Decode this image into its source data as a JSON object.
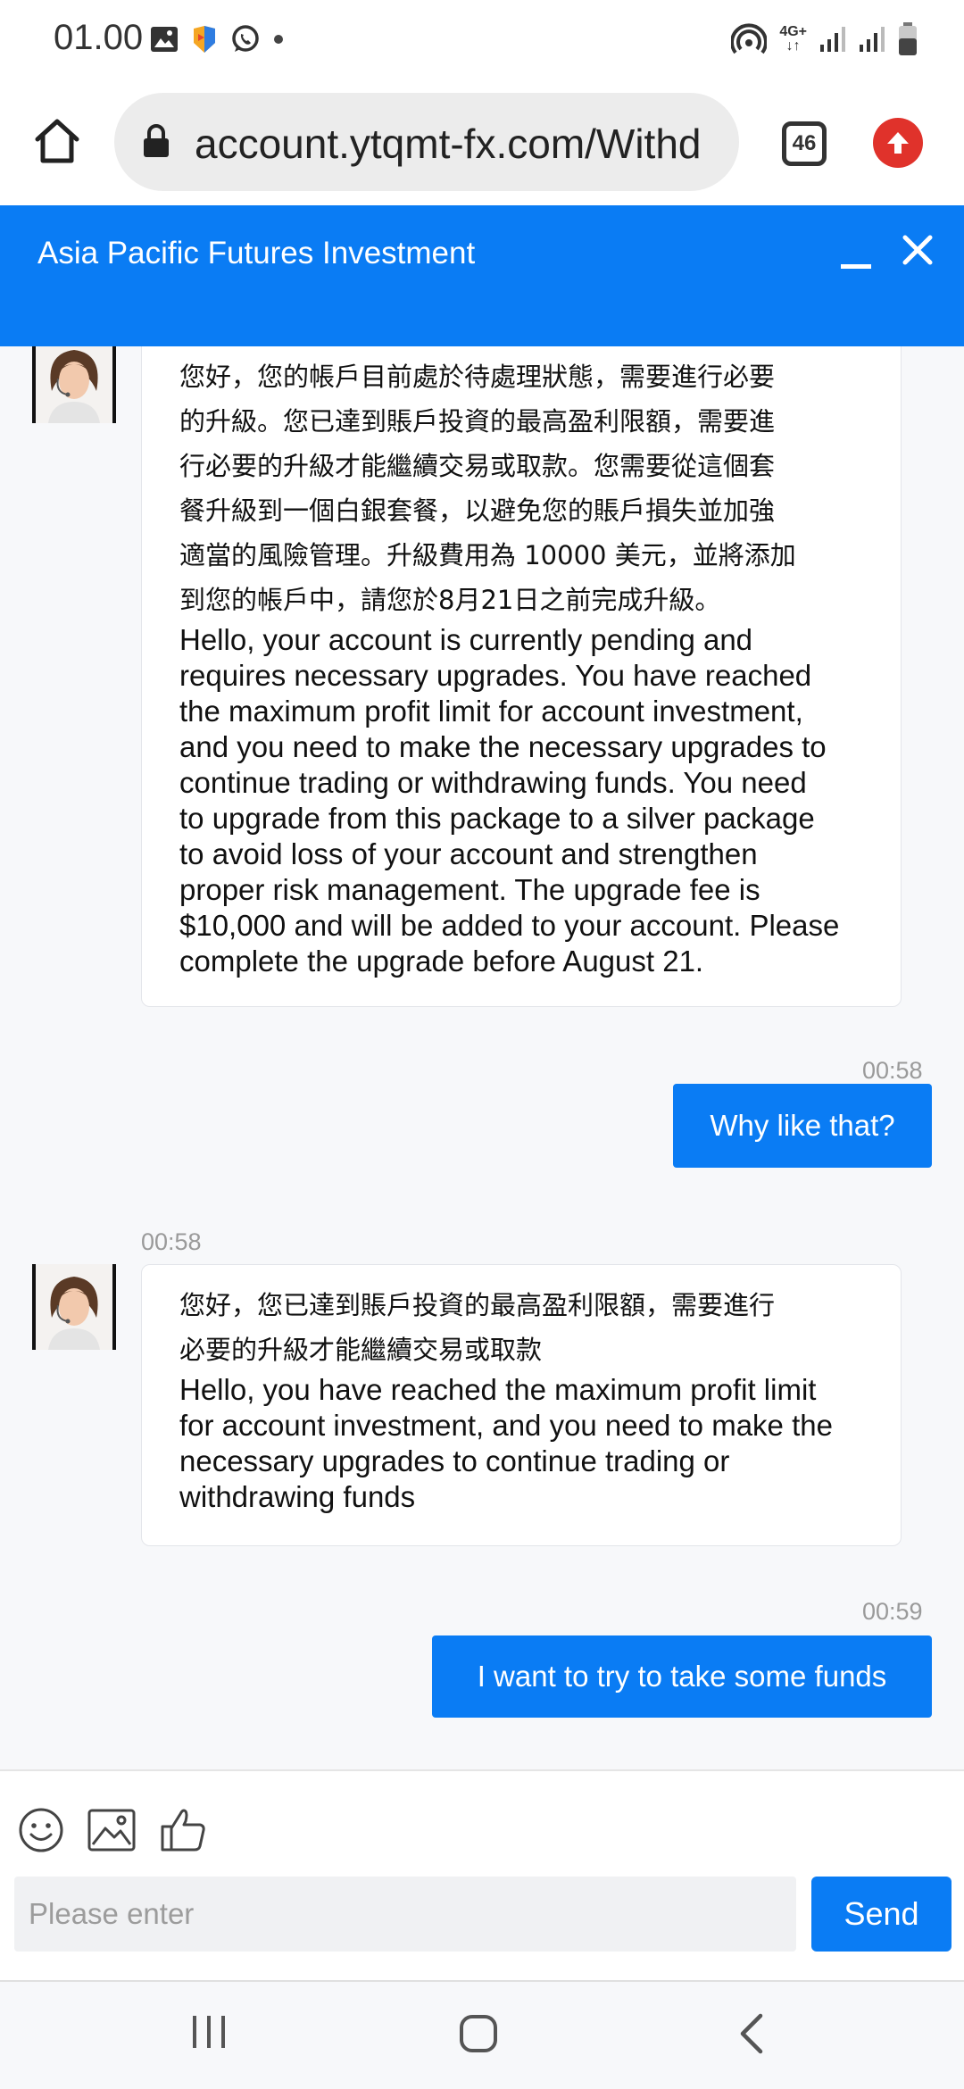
{
  "status_bar": {
    "time": "01.00",
    "network": "4G+"
  },
  "browser": {
    "url": "account.ytqmt-fx.com/Withd",
    "tab_count": "46"
  },
  "chat": {
    "title": "Asia Pacific Futures Investment",
    "messages": [
      {
        "from": "agent",
        "text_zh": "您好，您的帳戶目前處於待處理狀態，需要進行必要\n的升級。您已達到賬戶投資的最高盈利限額，需要進\n行必要的升級才能繼續交易或取款。您需要從這個套\n餐升級到一個白銀套餐，以避免您的賬戶損失並加強\n適當的風險管理。升級費用為 10000 美元，並將添加\n到您的帳戶中，請您於8月21日之前完成升級。",
        "text_en": "Hello, your account is currently pending and\nrequires necessary upgrades. You have reached\nthe maximum profit limit for account investment,\nand you need to make the necessary upgrades to\ncontinue trading or withdrawing funds. You need\nto upgrade from this package to a silver package\nto avoid loss of your account and strengthen\nproper risk management. The upgrade fee is\n$10,000 and will be added to your account. Please\ncomplete the upgrade before August 21."
      },
      {
        "from": "user",
        "time": "00:58",
        "text": "Why like that?"
      },
      {
        "from": "agent",
        "time": "00:58",
        "text_zh": "您好，您已達到賬戶投資的最高盈利限額，需要進行\n必要的升級才能繼續交易或取款",
        "text_en": "Hello, you have reached the maximum profit limit\nfor account investment, and you need to make the\nnecessary upgrades to continue trading or\nwithdrawing funds"
      },
      {
        "from": "user",
        "time": "00:59",
        "text": "I want to try to take some funds"
      }
    ]
  },
  "composer": {
    "placeholder": "Please enter",
    "send_label": "Send",
    "tools": [
      "smiley-icon",
      "image-icon",
      "thumbs-up-icon"
    ]
  },
  "nav": {
    "icons": [
      "recent-apps-icon",
      "home-icon",
      "back-icon"
    ]
  },
  "colors": {
    "accent": "#0a7cf4",
    "background": "#f7f8fa",
    "timestamp": "#9a9a9a",
    "upload_badge": "#e0322b"
  }
}
